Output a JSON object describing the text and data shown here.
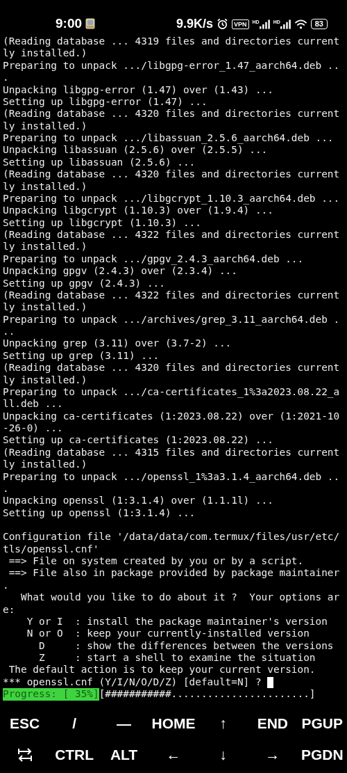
{
  "status_bar": {
    "time": "9:00",
    "net_speed": "9.9K/s",
    "vpn": "VPN",
    "signals": [
      {
        "label": "HD"
      },
      {
        "label": "HD"
      }
    ],
    "battery": "83"
  },
  "terminal": {
    "lines": [
      {
        "kind": "text",
        "text": "(Reading database ... 4319 files and directories current"
      },
      {
        "kind": "text",
        "text": "ly installed.)"
      },
      {
        "kind": "text",
        "text": "Preparing to unpack .../libgpg-error_1.47_aarch64.deb .."
      },
      {
        "kind": "text",
        "text": "."
      },
      {
        "kind": "text",
        "text": "Unpacking libgpg-error (1.47) over (1.43) ..."
      },
      {
        "kind": "text",
        "text": "Setting up libgpg-error (1.47) ..."
      },
      {
        "kind": "text",
        "text": "(Reading database ... 4320 files and directories current"
      },
      {
        "kind": "text",
        "text": "ly installed.)"
      },
      {
        "kind": "text",
        "text": "Preparing to unpack .../libassuan_2.5.6_aarch64.deb ..."
      },
      {
        "kind": "text",
        "text": "Unpacking libassuan (2.5.6) over (2.5.5) ..."
      },
      {
        "kind": "text",
        "text": "Setting up libassuan (2.5.6) ..."
      },
      {
        "kind": "text",
        "text": "(Reading database ... 4320 files and directories current"
      },
      {
        "kind": "text",
        "text": "ly installed.)"
      },
      {
        "kind": "text",
        "text": "Preparing to unpack .../libgcrypt_1.10.3_aarch64.deb ..."
      },
      {
        "kind": "text",
        "text": "Unpacking libgcrypt (1.10.3) over (1.9.4) ..."
      },
      {
        "kind": "text",
        "text": "Setting up libgcrypt (1.10.3) ..."
      },
      {
        "kind": "text",
        "text": "(Reading database ... 4322 files and directories current"
      },
      {
        "kind": "text",
        "text": "ly installed.)"
      },
      {
        "kind": "text",
        "text": "Preparing to unpack .../gpgv_2.4.3_aarch64.deb ..."
      },
      {
        "kind": "text",
        "text": "Unpacking gpgv (2.4.3) over (2.3.4) ..."
      },
      {
        "kind": "text",
        "text": "Setting up gpgv (2.4.3) ..."
      },
      {
        "kind": "text",
        "text": "(Reading database ... 4322 files and directories current"
      },
      {
        "kind": "text",
        "text": "ly installed.)"
      },
      {
        "kind": "text",
        "text": "Preparing to unpack .../archives/grep_3.11_aarch64.deb ."
      },
      {
        "kind": "text",
        "text": ".."
      },
      {
        "kind": "text",
        "text": "Unpacking grep (3.11) over (3.7-2) ..."
      },
      {
        "kind": "text",
        "text": "Setting up grep (3.11) ..."
      },
      {
        "kind": "text",
        "text": "(Reading database ... 4320 files and directories current"
      },
      {
        "kind": "text",
        "text": "ly installed.)"
      },
      {
        "kind": "text",
        "text": "Preparing to unpack .../ca-certificates_1%3a2023.08.22_a"
      },
      {
        "kind": "text",
        "text": "ll.deb ..."
      },
      {
        "kind": "text",
        "text": "Unpacking ca-certificates (1:2023.08.22) over (1:2021-10"
      },
      {
        "kind": "text",
        "text": "-26-0) ..."
      },
      {
        "kind": "text",
        "text": "Setting up ca-certificates (1:2023.08.22) ..."
      },
      {
        "kind": "text",
        "text": "(Reading database ... 4315 files and directories current"
      },
      {
        "kind": "text",
        "text": "ly installed.)"
      },
      {
        "kind": "text",
        "text": "Preparing to unpack .../openssl_1%3a3.1.4_aarch64.deb .."
      },
      {
        "kind": "text",
        "text": "."
      },
      {
        "kind": "text",
        "text": "Unpacking openssl (1:3.1.4) over (1.1.1l) ..."
      },
      {
        "kind": "text",
        "text": "Setting up openssl (1:3.1.4) ..."
      },
      {
        "kind": "blank"
      },
      {
        "kind": "text",
        "text": "Configuration file '/data/data/com.termux/files/usr/etc/"
      },
      {
        "kind": "text",
        "text": "tls/openssl.cnf'"
      },
      {
        "kind": "text",
        "text": " ==> File on system created by you or by a script."
      },
      {
        "kind": "text",
        "text": " ==> File also in package provided by package maintainer"
      },
      {
        "kind": "text",
        "text": "."
      },
      {
        "kind": "text",
        "text": "   What would you like to do about it ?  Your options ar"
      },
      {
        "kind": "text",
        "text": "e:"
      },
      {
        "kind": "text",
        "text": "    Y or I  : install the package maintainer's version"
      },
      {
        "kind": "text",
        "text": "    N or O  : keep your currently-installed version"
      },
      {
        "kind": "text",
        "text": "      D     : show the differences between the versions"
      },
      {
        "kind": "text",
        "text": "      Z     : start a shell to examine the situation"
      },
      {
        "kind": "text",
        "text": " The default action is to keep your current version."
      },
      {
        "kind": "prompt",
        "text": "*** openssl.cnf (Y/I/N/O/D/Z) [default=N] ? "
      },
      {
        "kind": "progress",
        "label": "Progress: [ 35%]",
        "bar": "[###########.......................]"
      }
    ]
  },
  "extra_keys": [
    [
      {
        "kind": "text",
        "label": "ESC"
      },
      {
        "kind": "text",
        "label": "/"
      },
      {
        "kind": "text",
        "label": "—"
      },
      {
        "kind": "text",
        "label": "HOME"
      },
      {
        "kind": "text",
        "label": "↑"
      },
      {
        "kind": "text",
        "label": "END"
      },
      {
        "kind": "text",
        "label": "PGUP"
      }
    ],
    [
      {
        "kind": "tab"
      },
      {
        "kind": "text",
        "label": "CTRL"
      },
      {
        "kind": "text",
        "label": "ALT"
      },
      {
        "kind": "text",
        "label": "←"
      },
      {
        "kind": "text",
        "label": "↓"
      },
      {
        "kind": "text",
        "label": "→"
      },
      {
        "kind": "text",
        "label": "PGDN"
      }
    ]
  ]
}
